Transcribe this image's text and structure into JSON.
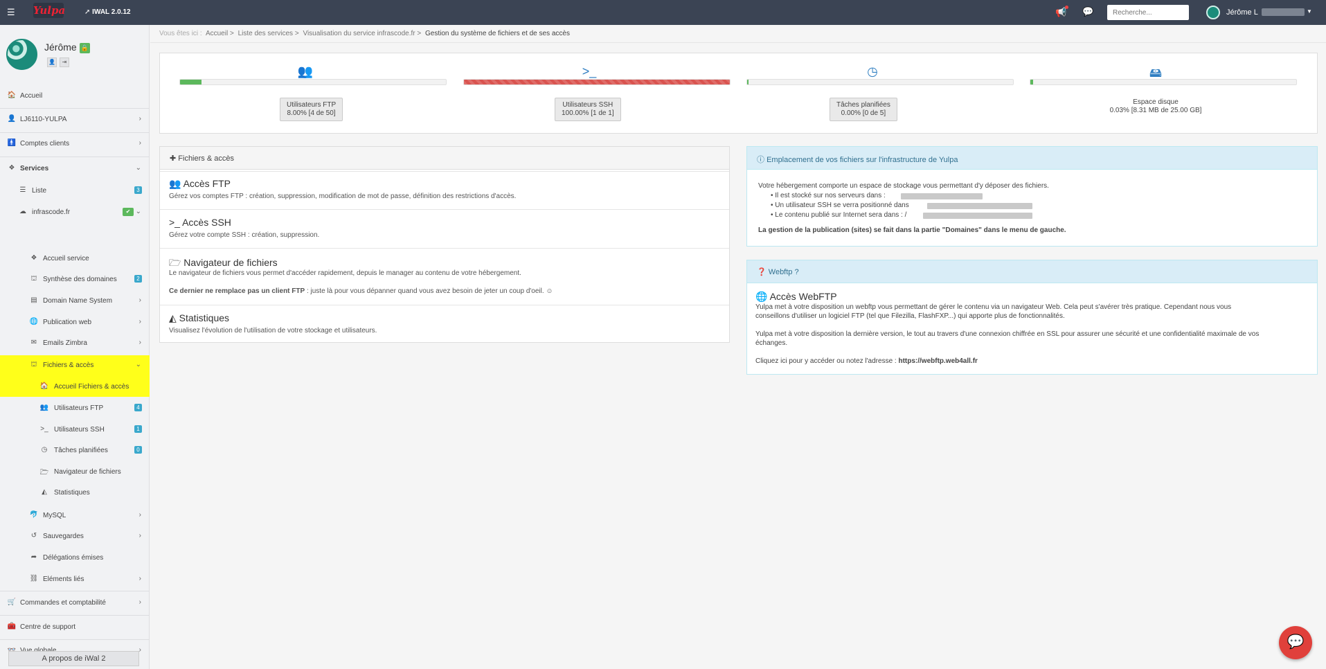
{
  "topbar": {
    "menu_icon": "menu-toggle-icon",
    "logo_text": "Yulpa",
    "version": "IWAL 2.0.12",
    "search_placeholder": "Recherche...",
    "user_name": "Jérôme L"
  },
  "profile": {
    "name": "Jérôme",
    "badge_icon": "user-lock-icon"
  },
  "sidebar": {
    "accueil": "Accueil",
    "account": "LJ6110-YULPA",
    "comptes": "Comptes clients",
    "services": "Services",
    "liste": "Liste",
    "liste_count": "3",
    "domain": "infrascode.fr",
    "accueil_service": "Accueil service",
    "synthese": "Synthèse des domaines",
    "synthese_count": "2",
    "dns": "Domain Name System",
    "publication": "Publication web",
    "emails": "Emails Zimbra",
    "fichiers": "Fichiers & accès",
    "accueil_fichiers": "Accueil Fichiers & accès",
    "ftp_users": "Utilisateurs FTP",
    "ftp_count": "4",
    "ssh_users": "Utilisateurs SSH",
    "ssh_count": "1",
    "taches": "Tâches planifiées",
    "taches_count": "0",
    "navigateur": "Navigateur de fichiers",
    "statistiques": "Statistiques",
    "mysql": "MySQL",
    "sauvegardes": "Sauvegardes",
    "delegations": "Délégations émises",
    "elements": "Eléments liés",
    "commandes": "Commandes et comptabilité",
    "support": "Centre de support",
    "vue": "Vue globale",
    "about": "A propos de iWal 2"
  },
  "breadcrumb": {
    "prefix": "Vous êtes ici :",
    "items": [
      "Accueil >",
      "Liste des services >",
      "Visualisation du service infrascode.fr >"
    ],
    "current": "Gestion du système de fichiers et de ses accès"
  },
  "stats": [
    {
      "label": "Utilisateurs FTP",
      "value": "8.00% [4 de 50]",
      "fraction": 0.08,
      "color": "#5cb85c"
    },
    {
      "label": "Utilisateurs SSH",
      "value": "100.00% [1 de 1]",
      "fraction": 1.0,
      "color": "#d9534f"
    },
    {
      "label": "Tâches planifiées",
      "value": "0.00% [0 de 5]",
      "fraction": 0.0,
      "color": "#5cb85c"
    },
    {
      "label": "Espace disque",
      "value": "0.03% [8.31 MB de 25.00 GB]",
      "fraction": 0.0003,
      "color": "#5cb85c"
    }
  ],
  "fichiers_panel": {
    "title": "Fichiers & accès",
    "ftp_title": "Accès FTP",
    "ftp_desc": "Gérez vos comptes FTP : création, suppression, modification de mot de passe, définition des restrictions d'accès.",
    "ssh_title": "Accès SSH",
    "ssh_desc": "Gérez votre compte SSH : création, suppression.",
    "nav_title": "Navigateur de fichiers",
    "nav_desc": "Le navigateur de fichiers vous permet d'accéder rapidement, depuis le manager au contenu de votre hébergement.",
    "nav_warn_bold": "Ce dernier ne remplace pas un client FTP",
    "nav_warn_rest": " : juste là pour vous dépanner quand vous avez besoin de jeter un coup d'oeil. ☺",
    "stats_title": "Statistiques",
    "stats_desc": "Visualisez l'évolution de l'utilisation de votre stockage et utilisateurs."
  },
  "emplacement_panel": {
    "title": "Emplacement de vos fichiers sur l'infrastructure de Yulpa",
    "intro": "Votre hébergement comporte un espace de stockage vous permettant d'y déposer des fichiers.",
    "li1": "Il est stocké sur nos serveurs dans :",
    "li2": "Un utilisateur SSH se verra positionné dans",
    "li3": "Le contenu publié sur Internet sera dans : /",
    "note": "La gestion de la publication (sites) se fait dans la partie \"Domaines\" dans le menu de gauche."
  },
  "webftp_panel": {
    "title": "Webftp ?",
    "heading": "Accès WebFTP",
    "p1a": "Yulpa met à votre disposition un webftp vous permettant de gérer le contenu via un navigateur Web. Cela peut s'avérer très pratique. Cependant nous vous",
    "p1b": "conseillons d'utiliser un logiciel FTP (tel que Filezilla, FlashFXP...) qui apporte plus de fonctionnalités.",
    "p2a": "Yulpa met à votre disposition la dernière version, le tout au travers d'une connexion chiffrée en SSL pour assurer une sécurité et une confidentialité maximale de vos",
    "p2b": "échanges.",
    "p3": "Cliquez ici pour y accéder ou notez l'adresse : ",
    "url": "https://webftp.web4all.fr"
  }
}
